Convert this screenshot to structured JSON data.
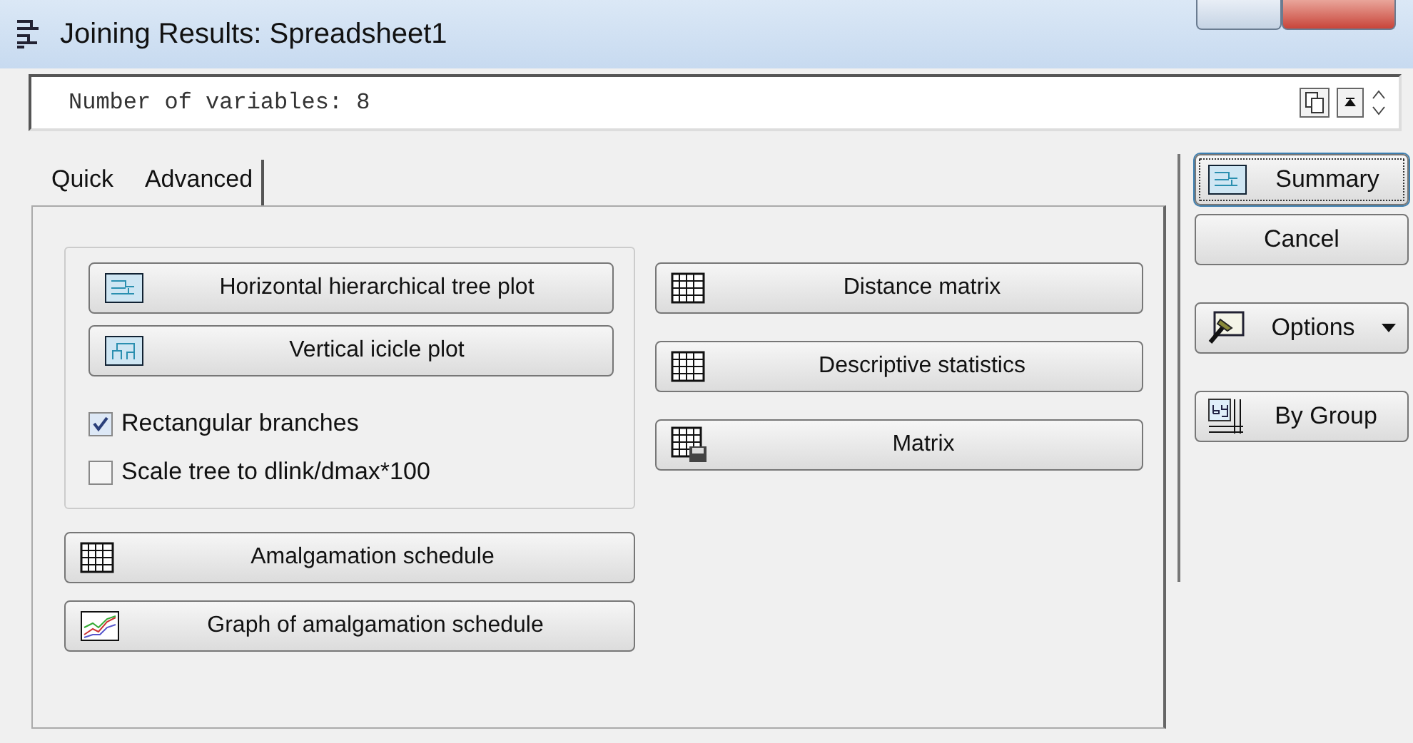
{
  "window": {
    "title": "Joining Results: Spreadsheet1"
  },
  "summary_line": {
    "text": "Number of variables: 8"
  },
  "tabs": [
    {
      "label": "Quick",
      "selected": false
    },
    {
      "label": "Advanced",
      "selected": true
    }
  ],
  "tree_group": {
    "buttons": [
      {
        "label": "Horizontal hierarchical tree plot",
        "kind": "tree"
      },
      {
        "label": "Vertical icicle plot",
        "kind": "icicle"
      }
    ],
    "options": [
      {
        "label": "Rectangular branches",
        "checked": true
      },
      {
        "label": "Scale tree to dlink/dmax*100",
        "checked": false
      }
    ]
  },
  "lower_buttons": [
    {
      "label": "Amalgamation schedule",
      "kind": "grid"
    },
    {
      "label": "Graph of amalgamation schedule",
      "kind": "graph"
    }
  ],
  "middle_buttons": [
    {
      "label": "Distance matrix",
      "kind": "grid"
    },
    {
      "label": "Descriptive statistics",
      "kind": "grid"
    },
    {
      "label": "Matrix",
      "kind": "gridsave"
    }
  ],
  "side_buttons": [
    {
      "label": "Summary",
      "kind": "tree",
      "focused": true
    },
    {
      "label": "Cancel",
      "kind": "plain",
      "focused": false
    },
    {
      "label": "Options",
      "kind": "options",
      "focused": false
    },
    {
      "label": "By Group",
      "kind": "bygroup",
      "focused": false
    }
  ]
}
